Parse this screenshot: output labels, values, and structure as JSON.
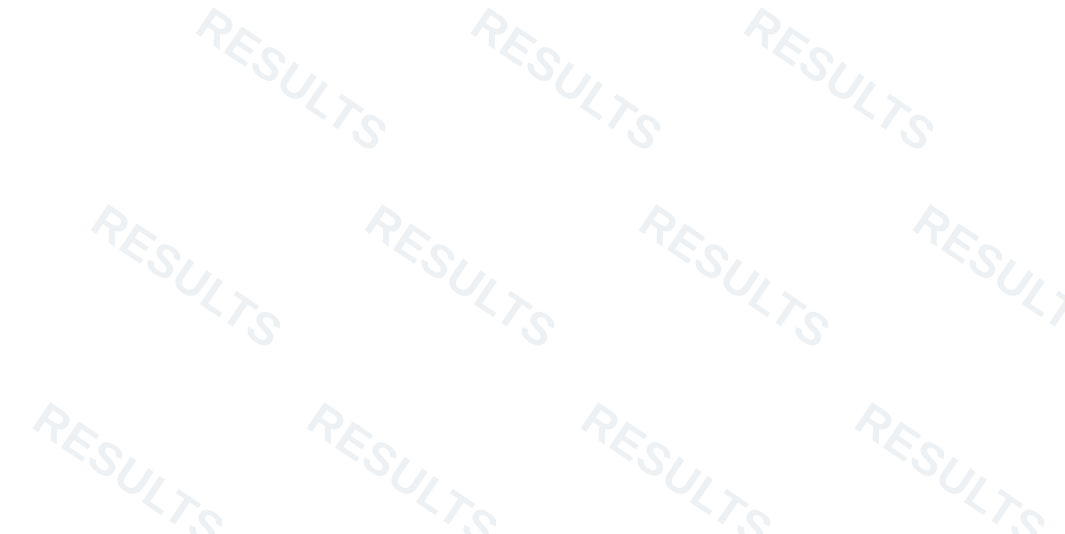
{
  "watermark": {
    "text": "RESULTS",
    "color": "#eef1f4"
  }
}
